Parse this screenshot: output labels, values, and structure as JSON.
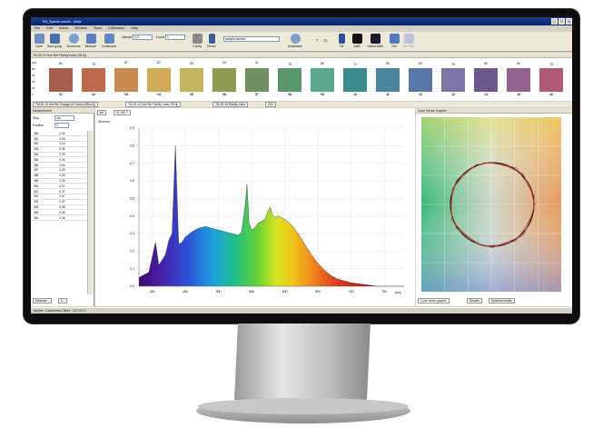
{
  "window": {
    "title": "TM_Spectrumsoft - Beta"
  },
  "menu": [
    "File",
    "Edit",
    "Action",
    "Window",
    "Tools",
    "Calibration",
    "Help"
  ],
  "toolbar": {
    "buttons": [
      "Open",
      "Save group",
      "Zoom max",
      "Measure",
      "Continuous",
      "Config",
      "Device",
      "Automation",
      "TM",
      "AMB",
      "Gamut AMB",
      "Ref",
      "Ref Rew"
    ],
    "interval_label": "Interval",
    "interval_value": "0,0",
    "count_label": "Count",
    "count_value": "1",
    "sample_value": "sample series1",
    "tool_letters": [
      "T",
      "SL"
    ]
  },
  "color_panel": {
    "header": "TM-30-15 Hue Bin Fidelity Index (Rf,hj)",
    "axis": [
      "100",
      "80",
      "60",
      "40",
      "20",
      "0"
    ],
    "bins": [
      {
        "label": "01",
        "value": "80",
        "level": 0.8,
        "color": "#a65d4c"
      },
      {
        "label": "02",
        "value": "75",
        "level": 0.75,
        "color": "#c06a4d"
      },
      {
        "label": "03",
        "value": "87",
        "level": 0.87,
        "color": "#c98a4e"
      },
      {
        "label": "04",
        "value": "87",
        "level": 0.87,
        "color": "#d0ac5a"
      },
      {
        "label": "05",
        "value": "83",
        "level": 0.83,
        "color": "#c4b460"
      },
      {
        "label": "06",
        "value": "93",
        "level": 0.93,
        "color": "#8f9a55"
      },
      {
        "label": "07",
        "value": "91",
        "level": 0.91,
        "color": "#6f9360"
      },
      {
        "label": "08",
        "value": "75",
        "level": 0.75,
        "color": "#5b976d"
      },
      {
        "label": "09",
        "value": "85",
        "level": 0.85,
        "color": "#5aa88b"
      },
      {
        "label": "10",
        "value": "72",
        "level": 0.72,
        "color": "#3d8c8c"
      },
      {
        "label": "11",
        "value": "80",
        "level": 0.8,
        "color": "#4a86a0"
      },
      {
        "label": "12",
        "value": "80",
        "level": 0.8,
        "color": "#5778a8"
      },
      {
        "label": "13",
        "value": "75",
        "level": 0.75,
        "color": "#7a76a8"
      },
      {
        "label": "14",
        "value": "80",
        "level": 0.8,
        "color": "#6d5a8c"
      },
      {
        "label": "15",
        "value": "80",
        "level": 0.8,
        "color": "#94628f"
      },
      {
        "label": "16",
        "value": "75",
        "level": 0.75,
        "color": "#b05a78"
      }
    ]
  },
  "tabs_top": [
    "TM-30-15 Hue Bin Change of Chroma (Rcs,hj)",
    "TM-30-15 Hue Bin Fidelity Index (Rf,hj)",
    "TM-30-15 Fidelity Index",
    "CRI"
  ],
  "measurement": {
    "header": "Measurement",
    "step_label": "Step",
    "step_value": "nm",
    "position_label": "Position",
    "position_value": "2",
    "rows": [
      [
        "380",
        "0,34"
      ],
      [
        "381",
        "0,35"
      ],
      [
        "382",
        "0,33"
      ],
      [
        "383",
        "0,35"
      ],
      [
        "384",
        "0,33"
      ],
      [
        "385",
        "0,35"
      ],
      [
        "386",
        "0,33"
      ],
      [
        "387",
        "0,36"
      ],
      [
        "388",
        "0,36"
      ],
      [
        "389",
        "0,36"
      ],
      [
        "390",
        "0,37"
      ],
      [
        "391",
        "0,37"
      ],
      [
        "392",
        "0,37"
      ],
      [
        "393",
        "0,37"
      ],
      [
        "394",
        "0,38"
      ],
      [
        "395",
        "0,38"
      ],
      [
        "396",
        "0,38"
      ]
    ],
    "bottom_tabs": [
      "Measure...",
      "0..."
    ]
  },
  "spectrum": {
    "tabs": [
      "All",
      "01-03E F"
    ],
    "ylabel": "W/m²nm",
    "xunit": "[nm]",
    "chart_data": {
      "type": "area",
      "xlabel": "[nm]",
      "ylabel": "W/m²nm",
      "xlim": [
        380,
        780
      ],
      "ylim": [
        0,
        0.9
      ],
      "x_ticks": [
        "400",
        "450",
        "500",
        "550",
        "600",
        "650",
        "700",
        "750"
      ],
      "y_ticks": [
        "0.9",
        "0.8",
        "0.7",
        "0.6",
        "0.5",
        "0.4",
        "0.3",
        "0.2",
        "0.1",
        "0.0"
      ],
      "x": [
        380,
        395,
        405,
        410,
        420,
        425,
        430,
        435,
        440,
        445,
        450,
        460,
        470,
        480,
        490,
        500,
        510,
        520,
        530,
        535,
        540,
        543,
        546,
        549,
        552,
        560,
        570,
        575,
        578,
        581,
        585,
        590,
        600,
        610,
        620,
        630,
        640,
        650,
        660,
        670,
        680,
        700,
        720,
        740,
        760,
        780
      ],
      "values": [
        0.05,
        0.08,
        0.25,
        0.12,
        0.18,
        0.26,
        0.3,
        0.8,
        0.24,
        0.25,
        0.28,
        0.31,
        0.33,
        0.34,
        0.33,
        0.32,
        0.31,
        0.3,
        0.29,
        0.31,
        0.45,
        0.58,
        0.36,
        0.33,
        0.32,
        0.36,
        0.38,
        0.43,
        0.45,
        0.41,
        0.39,
        0.4,
        0.38,
        0.35,
        0.3,
        0.24,
        0.18,
        0.13,
        0.09,
        0.06,
        0.04,
        0.02,
        0.01,
        0.0,
        0.0,
        0.0
      ]
    }
  },
  "color_vector": {
    "header": "Color Vector Graphic",
    "bottom_tabs": [
      "Color vector graphic",
      "Results",
      "Selected results"
    ]
  },
  "status": {
    "text": "Device : Connection Client - 127.0.0.1"
  }
}
